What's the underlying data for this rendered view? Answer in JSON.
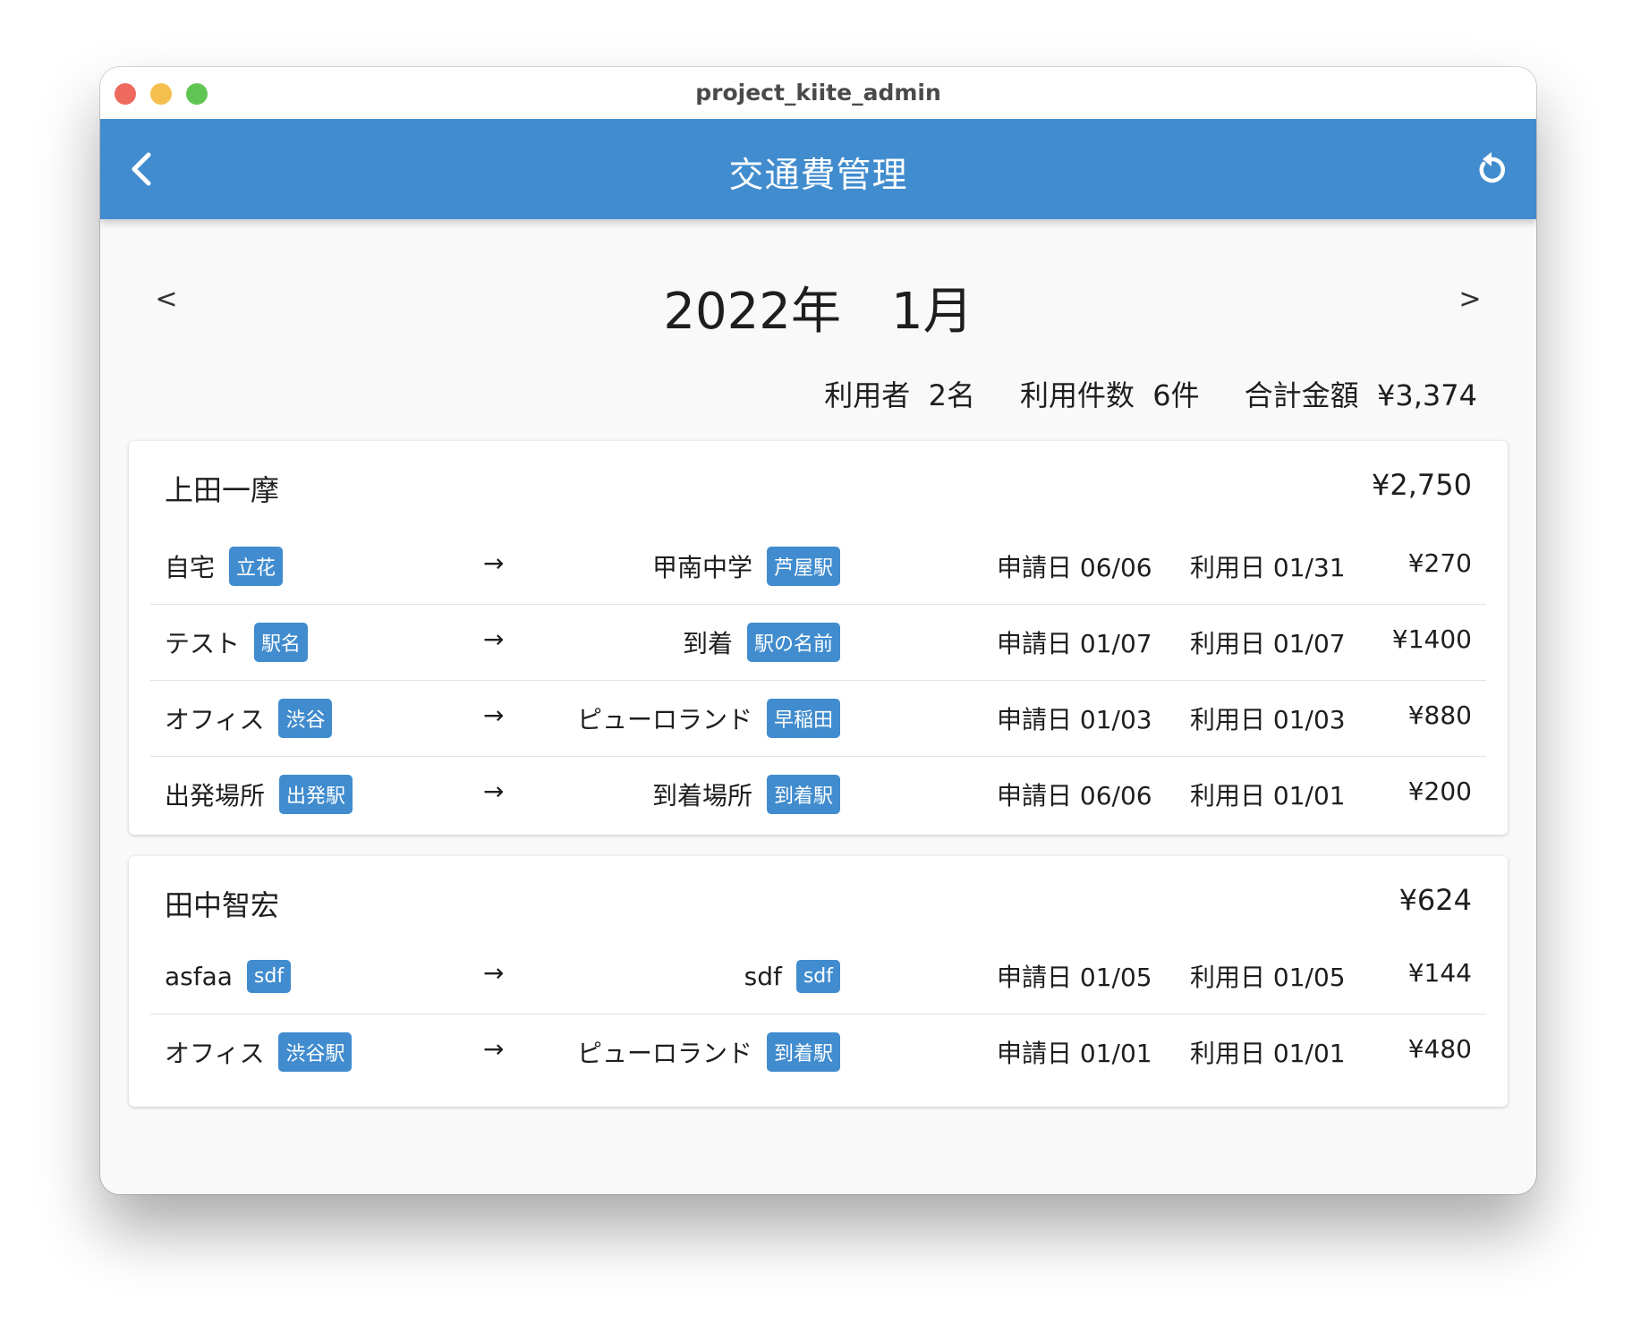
{
  "window": {
    "title": "project_kiite_admin"
  },
  "appbar": {
    "title": "交通費管理",
    "back_icon": "chevron-left-icon",
    "refresh_icon": "refresh-icon",
    "color": "#418cce"
  },
  "month_nav": {
    "prev": "<",
    "label": "2022年　1月",
    "next": ">"
  },
  "summary": {
    "users": "利用者  2名",
    "count": "利用件数  6件",
    "total": "合計金額  ¥3,374"
  },
  "arrow": "→",
  "cards": [
    {
      "name": "上田一摩",
      "total": "¥2,750",
      "rows": [
        {
          "from": "自宅",
          "from_station": "立花",
          "to": "甲南中学",
          "to_station": "芦屋駅",
          "applied": "申請日 06/06",
          "used": "利用日 01/31",
          "amount": "¥270"
        },
        {
          "from": "テスト",
          "from_station": "駅名",
          "to": "到着",
          "to_station": "駅の名前",
          "applied": "申請日 01/07",
          "used": "利用日 01/07",
          "amount": "¥1400"
        },
        {
          "from": "オフィス",
          "from_station": "渋谷",
          "to": "ピューロランド",
          "to_station": "早稲田",
          "applied": "申請日 01/03",
          "used": "利用日 01/03",
          "amount": "¥880"
        },
        {
          "from": "出発場所",
          "from_station": "出発駅",
          "to": "到着場所",
          "to_station": "到着駅",
          "applied": "申請日 06/06",
          "used": "利用日 01/01",
          "amount": "¥200"
        }
      ]
    },
    {
      "name": "田中智宏",
      "total": "¥624",
      "rows": [
        {
          "from": "asfaa",
          "from_station": "sdf",
          "to": "sdf",
          "to_station": "sdf",
          "applied": "申請日 01/05",
          "used": "利用日 01/05",
          "amount": "¥144"
        },
        {
          "from": "オフィス",
          "from_station": "渋谷駅",
          "to": "ピューロランド",
          "to_station": "到着駅",
          "applied": "申請日 01/01",
          "used": "利用日 01/01",
          "amount": "¥480"
        }
      ]
    }
  ]
}
